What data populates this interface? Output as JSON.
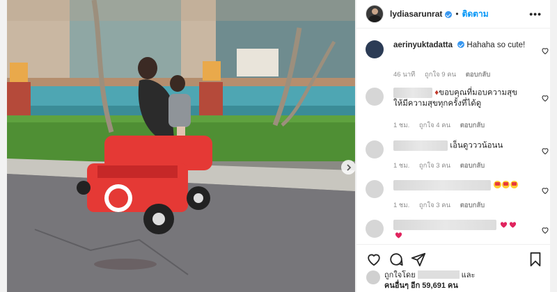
{
  "post": {
    "username": "lydiasarunrat",
    "dot": "•",
    "follow_label": "ติดตาม",
    "more_icon": "more-horizontal-icon"
  },
  "comments": [
    {
      "username": "aerinyuktadatta",
      "verified": true,
      "text": "Hahaha so cute!",
      "time": "46 นาที",
      "likes": "ถูกใจ 9 คน",
      "reply": "ตอบกลับ"
    },
    {
      "username_blurred": true,
      "text": "ขอบคุณที่มอบความสุขให้มีความสุขทุกครั้งที่ได้ดู",
      "time": "1 ชม.",
      "likes": "ถูกใจ 4 คน",
      "reply": "ตอบกลับ"
    },
    {
      "username_blurred": true,
      "text": "เอ็นดูวววน้อนน",
      "time": "1 ชม.",
      "likes": "ถูกใจ 3 คน",
      "reply": "ตอบกลับ"
    },
    {
      "username_blurred": true,
      "text": "",
      "emoji": "star-struck x3",
      "time": "1 ชม.",
      "likes": "ถูกใจ 3 คน",
      "reply": "ตอบกลับ"
    },
    {
      "username_blurred": true,
      "text": "",
      "emoji": "red-heart x3"
    }
  ],
  "footer": {
    "icons": [
      "heart-icon",
      "comment-icon",
      "share-icon",
      "bookmark-icon"
    ],
    "liked_by_prefix": "ถูกใจโดย",
    "liked_by_and": "และ",
    "liked_by_others": "คนอื่นๆ อีก 59,691 คน"
  },
  "colors": {
    "accent": "#0095f6",
    "verified": "#3897f0",
    "muted": "#8e8e8e",
    "scooter": "#e53935"
  }
}
